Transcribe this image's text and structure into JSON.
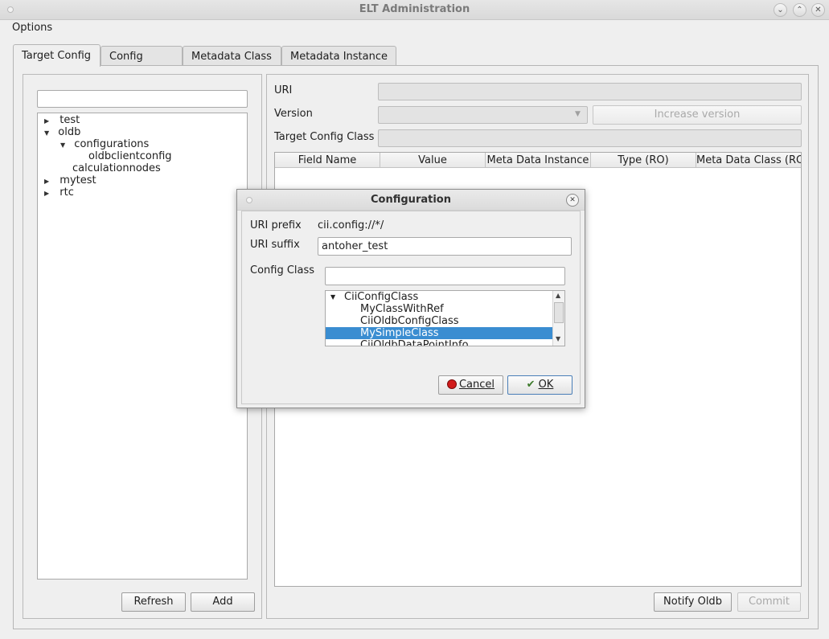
{
  "window": {
    "title": "ELT Administration"
  },
  "menu": {
    "options": "Options"
  },
  "tabs": [
    {
      "label": "Target Config",
      "active": true
    },
    {
      "label": "Config Class",
      "active": false
    },
    {
      "label": "Metadata Class",
      "active": false
    },
    {
      "label": "Metadata Instance",
      "active": false
    }
  ],
  "left_panel": {
    "filter_value": "",
    "tree": [
      {
        "label": "test",
        "level": 0,
        "expander": "collapsed"
      },
      {
        "label": "oldb",
        "level": 0,
        "expander": "expanded"
      },
      {
        "label": "configurations",
        "level": 1,
        "expander": "expanded"
      },
      {
        "label": "oldbclientconfig",
        "level": 2,
        "expander": "none"
      },
      {
        "label": "calculationnodes",
        "level": 1,
        "expander": "none"
      },
      {
        "label": "mytest",
        "level": 0,
        "expander": "collapsed"
      },
      {
        "label": "rtc",
        "level": 0,
        "expander": "collapsed"
      }
    ],
    "refresh_label": "Refresh",
    "add_label": "Add"
  },
  "right_panel": {
    "uri_label": "URI",
    "uri_value": "",
    "version_label": "Version",
    "version_value": "",
    "increase_version_label": "Increase version",
    "target_class_label": "Target Config Class",
    "target_class_value": "",
    "columns": [
      "Field Name",
      "Value",
      "Meta Data Instance",
      "Type (RO)",
      "Meta Data Class (RO"
    ],
    "notify_label": "Notify Oldb",
    "commit_label": "Commit"
  },
  "dialog": {
    "title": "Configuration",
    "uri_prefix_label": "URI prefix",
    "uri_prefix_value": "cii.config://*/",
    "uri_suffix_label": "URI suffix",
    "uri_suffix_value": "antoher_test",
    "config_class_label": "Config Class",
    "config_class_filter": "",
    "classes": [
      {
        "label": "CiiConfigClass",
        "level": 0,
        "expander": "expanded",
        "selected": false
      },
      {
        "label": "MyClassWithRef",
        "level": 1,
        "expander": "none",
        "selected": false
      },
      {
        "label": "CiiOldbConfigClass",
        "level": 1,
        "expander": "none",
        "selected": false
      },
      {
        "label": "MySimpleClass",
        "level": 1,
        "expander": "none",
        "selected": true
      },
      {
        "label": "CiiOldbDataPointInfo",
        "level": 1,
        "expander": "none",
        "selected": false
      }
    ],
    "cancel_label": "Cancel",
    "ok_label": "OK"
  },
  "colors": {
    "selection": "#3a8dd1",
    "cancel_icon": "#d11b1b"
  }
}
